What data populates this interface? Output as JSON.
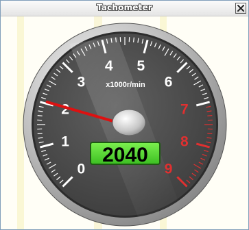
{
  "window": {
    "title": "Tachometer",
    "close_icon": "close-icon"
  },
  "gauge": {
    "unit_label": "x1000r/min",
    "rpm": 2040,
    "rpm_display": "2040",
    "scale_min": 0,
    "scale_max": 9,
    "redline_start": 7,
    "tick_labels": [
      "0",
      "1",
      "2",
      "3",
      "4",
      "5",
      "6",
      "7",
      "8",
      "9"
    ],
    "colors": {
      "dial_face": "#4b4b4b",
      "bezel": "#c8c8c8",
      "normal_tick": "#ffffff",
      "redline_tick": "#e03030",
      "needle": "#dd1111",
      "display_bg": "#55dd33",
      "display_text": "#000000"
    }
  }
}
